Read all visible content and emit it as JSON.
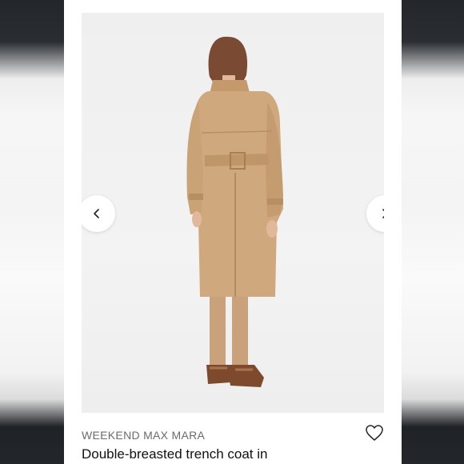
{
  "product": {
    "brand": "WEEKEND MAX MARA",
    "title": "Double-breasted trench coat in"
  },
  "carousel": {
    "prev_icon": "chevron-left-icon",
    "next_icon": "chevron-right-icon"
  },
  "actions": {
    "favorite_icon": "heart-outline-icon"
  },
  "colors": {
    "coat": "#cfa87e",
    "background": "#f1f1f1",
    "text_primary": "#111111",
    "text_secondary": "#6b6b6b"
  }
}
